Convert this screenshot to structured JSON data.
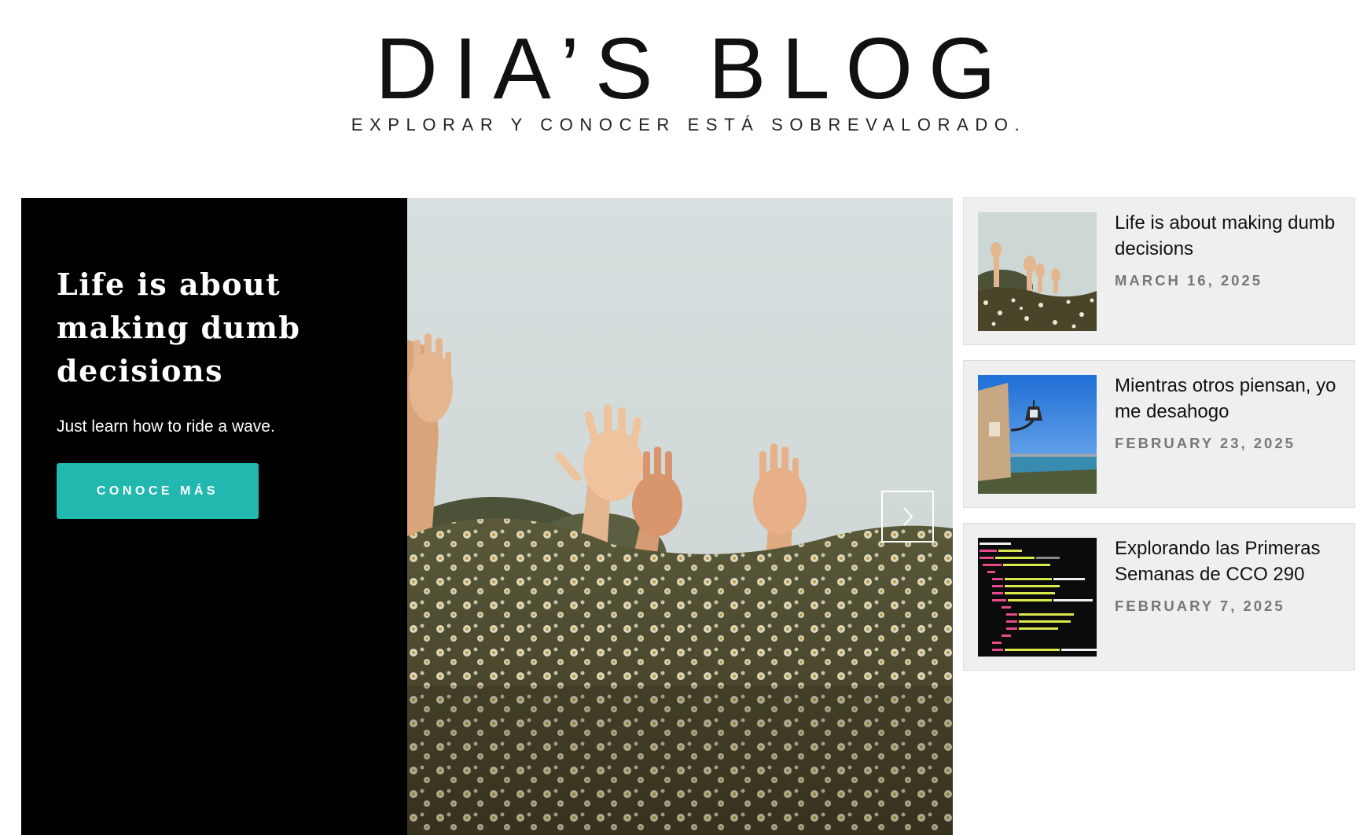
{
  "header": {
    "site_title": "DIA’S BLOG",
    "tagline": "EXPLORAR Y CONOCER ESTÁ SOBREVALORADO."
  },
  "hero": {
    "title": "Life is about making dumb decisions",
    "subtitle": "Just learn how to ride a wave.",
    "button_label": "CONOCE MÁS",
    "button_color": "#22b8b0",
    "background_color": "#000000",
    "image_icon": "raised-hands-in-flower-field-photo",
    "next_icon": "chevron-right-icon"
  },
  "posts": [
    {
      "title": "Life is about making dumb decisions",
      "date": "MARCH 16, 2025",
      "thumb_icon": "raised-hands-in-flower-field-photo"
    },
    {
      "title": "Mientras otros piensan, yo me desahogo",
      "date": "FEBRUARY 23, 2025",
      "thumb_icon": "street-lamp-over-sea-photo"
    },
    {
      "title": "Explorando las Primeras Semanas de CCO 290",
      "date": "FEBRUARY 7, 2025",
      "thumb_icon": "html-code-screen-photo"
    }
  ]
}
